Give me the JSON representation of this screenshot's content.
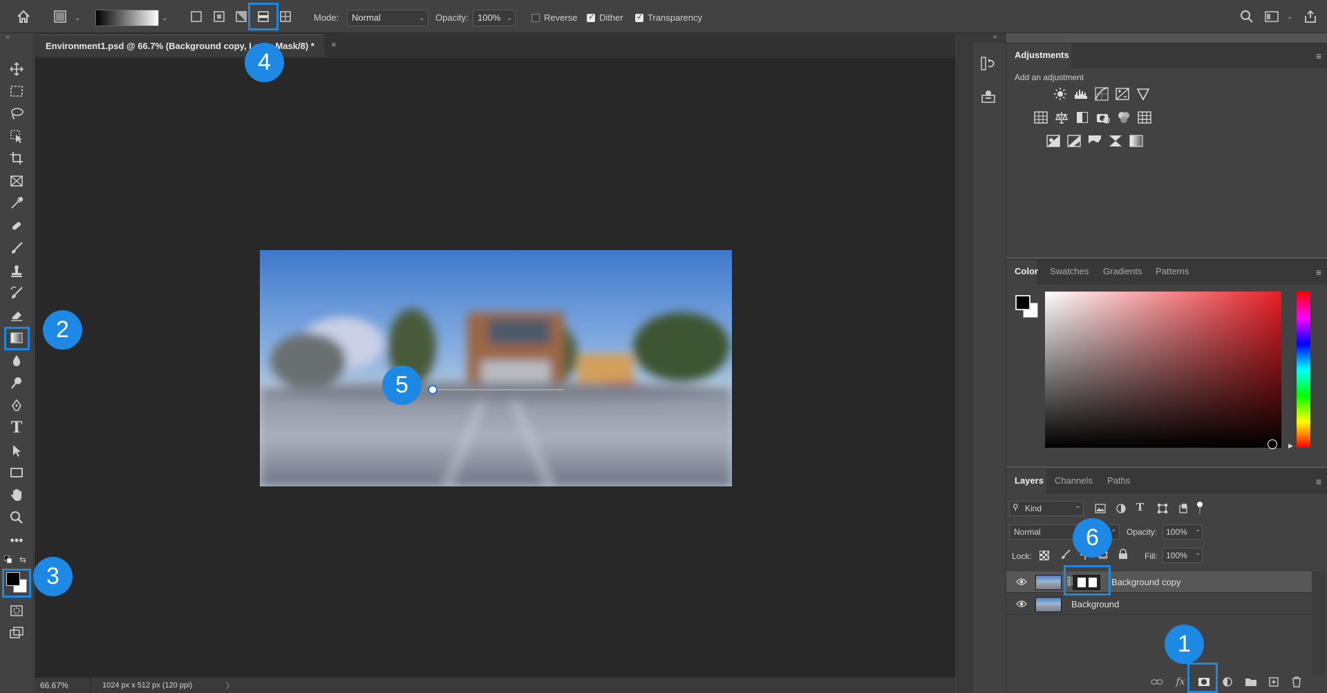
{
  "options_bar": {
    "mode_label": "Mode:",
    "mode_value": "Normal",
    "opacity_label": "Opacity:",
    "opacity_value": "100%",
    "reverse_label": "Reverse",
    "reverse_checked": false,
    "dither_label": "Dither",
    "dither_checked": true,
    "transparency_label": "Transparency",
    "transparency_checked": true,
    "gradient_types": [
      "linear",
      "radial",
      "angle",
      "reflected",
      "diamond"
    ],
    "selected_gradient_type": "reflected"
  },
  "document": {
    "tab_title": "Environment1.psd @ 66.7% (Background copy, Layer Mask/8) *",
    "tab_close": "×"
  },
  "status_bar": {
    "zoom": "66.67%",
    "doc_info": "1024 px x 512 px (120 ppi)",
    "arrow": "〉"
  },
  "adjustments_panel": {
    "tab": "Adjustments",
    "subtitle": "Add an adjustment",
    "rows": [
      [
        "brightness-contrast",
        "levels",
        "curves",
        "exposure",
        "vibrance"
      ],
      [
        "hue-saturation",
        "color-balance",
        "black-white",
        "photo-filter",
        "channel-mixer",
        "color-lookup"
      ],
      [
        "invert",
        "posterize",
        "threshold",
        "selective-color",
        "gradient-map"
      ]
    ]
  },
  "color_panel": {
    "tabs": [
      "Color",
      "Swatches",
      "Gradients",
      "Patterns"
    ],
    "active_tab": "Color",
    "foreground": "#000000",
    "background": "#ffffff",
    "hue_color": "#e81e25"
  },
  "layers_panel": {
    "tabs": [
      "Layers",
      "Channels",
      "Paths"
    ],
    "active_tab": "Layers",
    "filter_value": "Kind",
    "blend_mode": "Normal",
    "opacity_label": "Opacity:",
    "opacity_value": "100%",
    "lock_label": "Lock:",
    "fill_label": "Fill:",
    "fill_value": "100%",
    "layers": [
      {
        "name": "Background copy",
        "visible": true,
        "has_mask": true,
        "selected": true
      },
      {
        "name": "Background",
        "visible": true,
        "has_mask": false,
        "selected": false
      }
    ]
  },
  "callouts": [
    "1",
    "2",
    "3",
    "4",
    "5",
    "6"
  ]
}
